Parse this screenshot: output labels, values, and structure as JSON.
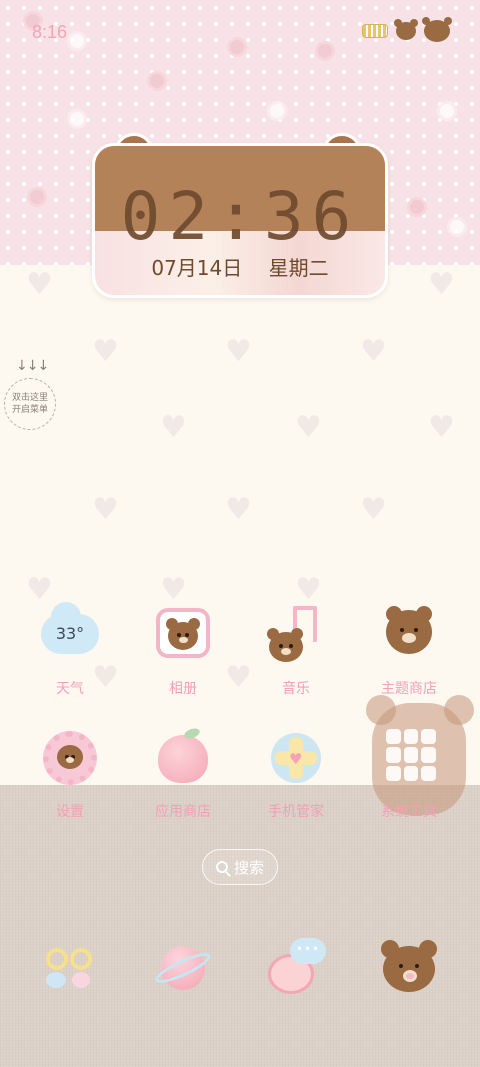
{
  "status_bar": {
    "time": "8:16"
  },
  "clock_widget": {
    "time": "02:36",
    "date": "07月14日",
    "weekday": "星期二"
  },
  "side_hint": {
    "line1": "双击这里",
    "line2": "开启菜单",
    "arrows": "↓↓↓"
  },
  "apps_row1": [
    {
      "label": "天气",
      "weather_temp": "33°"
    },
    {
      "label": "相册"
    },
    {
      "label": "音乐"
    },
    {
      "label": "主题商店"
    }
  ],
  "apps_row2": [
    {
      "label": "设置"
    },
    {
      "label": "应用商店"
    },
    {
      "label": "手机管家"
    },
    {
      "label": "系统工具"
    }
  ],
  "search": {
    "label": "搜索"
  },
  "dock": {
    "chat_dots": "•••"
  },
  "colors": {
    "label_pink": "#f3a0b4",
    "bear_brown": "#9a6a42",
    "clock_text": "#6f4a2e",
    "top_bg": "#f7e3e7",
    "bottom_bg": "#dcd1c8"
  }
}
